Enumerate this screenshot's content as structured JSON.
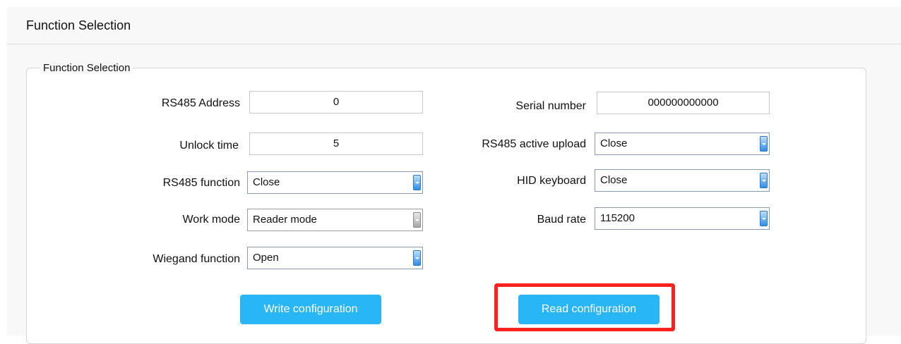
{
  "header": {
    "title": "Function Selection"
  },
  "group": {
    "legend": "Function Selection",
    "left": {
      "rs485_address": {
        "label": "RS485 Address",
        "value": "0"
      },
      "unlock_time": {
        "label": "Unlock time",
        "value": "5"
      },
      "rs485_function": {
        "label": "RS485 function",
        "value": "Close"
      },
      "work_mode": {
        "label": "Work mode",
        "value": "Reader mode"
      },
      "wiegand_function": {
        "label": "Wiegand function",
        "value": "Open"
      }
    },
    "right": {
      "serial_number": {
        "label": "Serial number",
        "value": "000000000000"
      },
      "rs485_active_upload": {
        "label": "RS485 active upload",
        "value": "Close"
      },
      "hid_keyboard": {
        "label": "HID keyboard",
        "value": "Close"
      },
      "baud_rate": {
        "label": "Baud rate",
        "value": "115200"
      }
    },
    "buttons": {
      "write": "Write configuration",
      "read": "Read configuration"
    }
  },
  "colors": {
    "button": "#29b6f6",
    "highlight": "#ff2020"
  }
}
